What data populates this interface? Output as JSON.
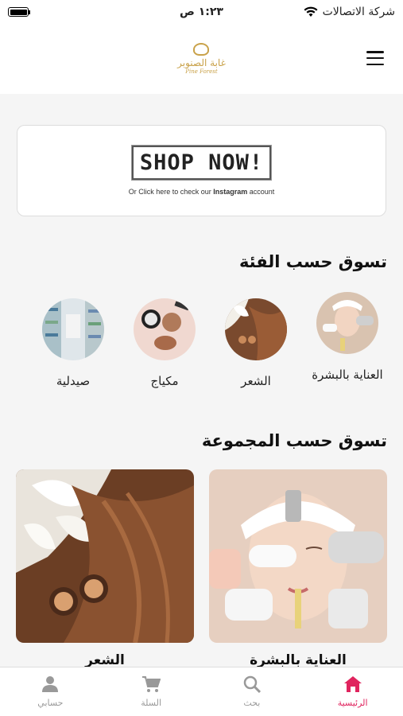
{
  "status": {
    "carrier": "شركة الاتصالات",
    "time": "١:٢٣ ص"
  },
  "header": {
    "logo_ar": "غابة الصنوبر",
    "logo_en": "Pine Forest"
  },
  "banner": {
    "headline": "SHOP NOW!",
    "sub_prefix": "Or Click here to check our ",
    "sub_bold": "Instagram",
    "sub_suffix": " account"
  },
  "categories_section": {
    "title": "تسوق حسب الفئة",
    "items": [
      {
        "label": "العناية بالبشرة",
        "icon": "skincare-photo"
      },
      {
        "label": "الشعر",
        "icon": "hair-photo"
      },
      {
        "label": "مكياج",
        "icon": "makeup-photo"
      },
      {
        "label": "صيدلية",
        "icon": "pharmacy-photo"
      }
    ]
  },
  "collections_section": {
    "title": "تسوق حسب المجموعة",
    "items": [
      {
        "label": "العناية بالبشرة"
      },
      {
        "label": "الشعر"
      }
    ]
  },
  "tabbar": {
    "items": [
      {
        "label": "الرئيسية",
        "icon": "home-icon",
        "active": true
      },
      {
        "label": "بحث",
        "icon": "search-icon",
        "active": false
      },
      {
        "label": "السلة",
        "icon": "cart-icon",
        "active": false
      },
      {
        "label": "حسابي",
        "icon": "user-icon",
        "active": false
      }
    ]
  },
  "colors": {
    "accent": "#e0245e",
    "brand_gold": "#c9a24a"
  }
}
